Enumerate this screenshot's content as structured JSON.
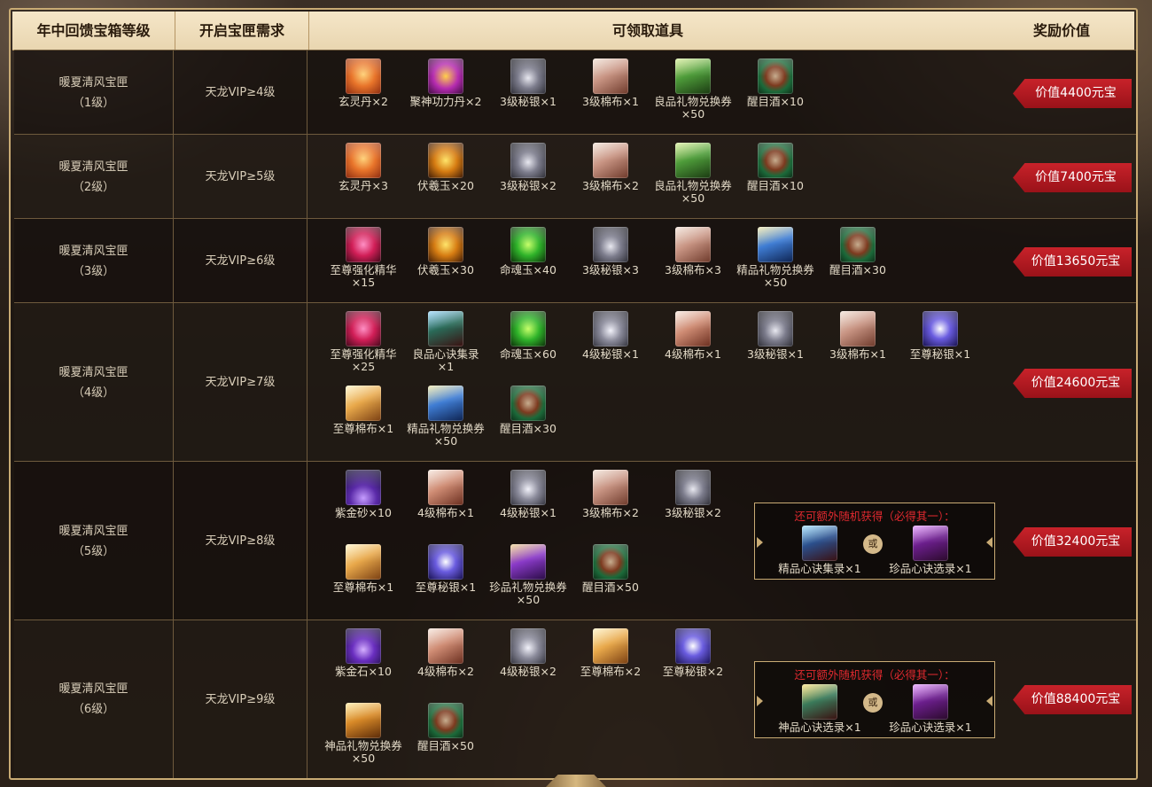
{
  "headers": {
    "level": "年中回馈宝箱等级",
    "requirement": "开启宝匣需求",
    "items": "可领取道具",
    "value": "奖励价值"
  },
  "rows": [
    {
      "name_line1": "暖夏清风宝匣",
      "name_line2": "（1级）",
      "requirement": "天龙VIP≥4级",
      "value": "价值4400元宝",
      "items": [
        {
          "icon": "xuanling-pill-icon",
          "label": "玄灵丹×2"
        },
        {
          "icon": "jushen-pill-icon",
          "label": "聚神功力丹×2"
        },
        {
          "icon": "silver-3-icon",
          "label": "3级秘银×1"
        },
        {
          "icon": "cloth-3-icon",
          "label": "3级棉布×1"
        },
        {
          "icon": "gift-voucher-good-icon",
          "label": "良品礼物兑换券×50"
        },
        {
          "icon": "wine-icon",
          "label": "醒目酒×10"
        }
      ]
    },
    {
      "name_line1": "暖夏清风宝匣",
      "name_line2": "（2级）",
      "requirement": "天龙VIP≥5级",
      "value": "价值7400元宝",
      "items": [
        {
          "icon": "xuanling-pill-icon",
          "label": "玄灵丹×3"
        },
        {
          "icon": "fuxi-jade-icon",
          "label": "伏羲玉×20"
        },
        {
          "icon": "silver-3-icon",
          "label": "3级秘银×2"
        },
        {
          "icon": "cloth-3-icon",
          "label": "3级棉布×2"
        },
        {
          "icon": "gift-voucher-good-icon",
          "label": "良品礼物兑换券×50"
        },
        {
          "icon": "wine-icon",
          "label": "醒目酒×10"
        }
      ]
    },
    {
      "name_line1": "暖夏清风宝匣",
      "name_line2": "（3级）",
      "requirement": "天龙VIP≥6级",
      "value": "价值13650元宝",
      "items": [
        {
          "icon": "supreme-essence-icon",
          "label": "至尊强化精华×15"
        },
        {
          "icon": "fuxi-jade-icon",
          "label": "伏羲玉×30"
        },
        {
          "icon": "minghun-jade-icon",
          "label": "命魂玉×40"
        },
        {
          "icon": "silver-3-icon",
          "label": "3级秘银×3"
        },
        {
          "icon": "cloth-3-icon",
          "label": "3级棉布×3"
        },
        {
          "icon": "gift-voucher-fine-icon",
          "label": "精品礼物兑换券×50"
        },
        {
          "icon": "wine-icon",
          "label": "醒目酒×30"
        }
      ]
    },
    {
      "name_line1": "暖夏清风宝匣",
      "name_line2": "（4级）",
      "requirement": "天龙VIP≥7级",
      "value": "价值24600元宝",
      "items": [
        {
          "icon": "supreme-essence-icon",
          "label": "至尊强化精华×25"
        },
        {
          "icon": "xinjue-good-icon",
          "label": "良品心诀集录×1"
        },
        {
          "icon": "minghun-jade-icon",
          "label": "命魂玉×60"
        },
        {
          "icon": "silver-4-icon",
          "label": "4级秘银×1"
        },
        {
          "icon": "cloth-4-icon",
          "label": "4级棉布×1"
        },
        {
          "icon": "silver-3-icon",
          "label": "3级秘银×1"
        },
        {
          "icon": "cloth-3-icon",
          "label": "3级棉布×1"
        },
        {
          "icon": "supreme-silver-icon",
          "label": "至尊秘银×1"
        },
        {
          "icon": "supreme-cloth-icon",
          "label": "至尊棉布×1"
        },
        {
          "icon": "gift-voucher-fine-icon",
          "label": "精品礼物兑换券×50"
        },
        {
          "icon": "wine-icon",
          "label": "醒目酒×30"
        }
      ]
    },
    {
      "name_line1": "暖夏清风宝匣",
      "name_line2": "（5级）",
      "requirement": "天龙VIP≥8级",
      "value": "价值32400元宝",
      "items": [
        {
          "icon": "purple-gold-sand-icon",
          "label": "紫金砂×10"
        },
        {
          "icon": "cloth-4-icon",
          "label": "4级棉布×1"
        },
        {
          "icon": "silver-4-icon",
          "label": "4级秘银×1"
        },
        {
          "icon": "cloth-3-icon",
          "label": "3级棉布×2"
        },
        {
          "icon": "silver-3-icon",
          "label": "3级秘银×2"
        },
        {
          "icon": "supreme-cloth-icon",
          "label": "至尊棉布×1"
        },
        {
          "icon": "supreme-silver-icon",
          "label": "至尊秘银×1"
        },
        {
          "icon": "gift-voucher-rare-icon",
          "label": "珍品礼物兑换券×50"
        },
        {
          "icon": "wine-icon",
          "label": "醒目酒×50"
        }
      ],
      "extra": {
        "title": "还可额外随机获得（必得其一）：",
        "or": "或",
        "a": {
          "icon": "xinjue-fine-icon",
          "label": "精品心诀集录×1"
        },
        "b": {
          "icon": "xinjue-rare-icon",
          "label": "珍品心诀选录×1"
        }
      }
    },
    {
      "name_line1": "暖夏清风宝匣",
      "name_line2": "（6级）",
      "requirement": "天龙VIP≥9级",
      "value": "价值88400元宝",
      "items": [
        {
          "icon": "purple-gold-stone-icon",
          "label": "紫金石×10"
        },
        {
          "icon": "cloth-4-icon",
          "label": "4级棉布×2"
        },
        {
          "icon": "silver-4-icon",
          "label": "4级秘银×2"
        },
        {
          "icon": "supreme-cloth-icon",
          "label": "至尊棉布×2"
        },
        {
          "icon": "supreme-silver-icon",
          "label": "至尊秘银×2"
        },
        {
          "icon": "gift-voucher-divine-icon",
          "label": "神品礼物兑换券×50"
        },
        {
          "icon": "wine-icon",
          "label": "醒目酒×50"
        }
      ],
      "extra": {
        "title": "还可额外随机获得（必得其一）：",
        "or": "或",
        "a": {
          "icon": "xinjue-divine-icon",
          "label": "神品心诀选录×1"
        },
        "b": {
          "icon": "xinjue-rare-icon",
          "label": "珍品心诀选录×1"
        }
      }
    }
  ],
  "colors": {
    "header_bg": "#f0e0bd",
    "frame": "#c9ab74",
    "badge": "#b81a22",
    "extra_title": "#e0292f"
  }
}
